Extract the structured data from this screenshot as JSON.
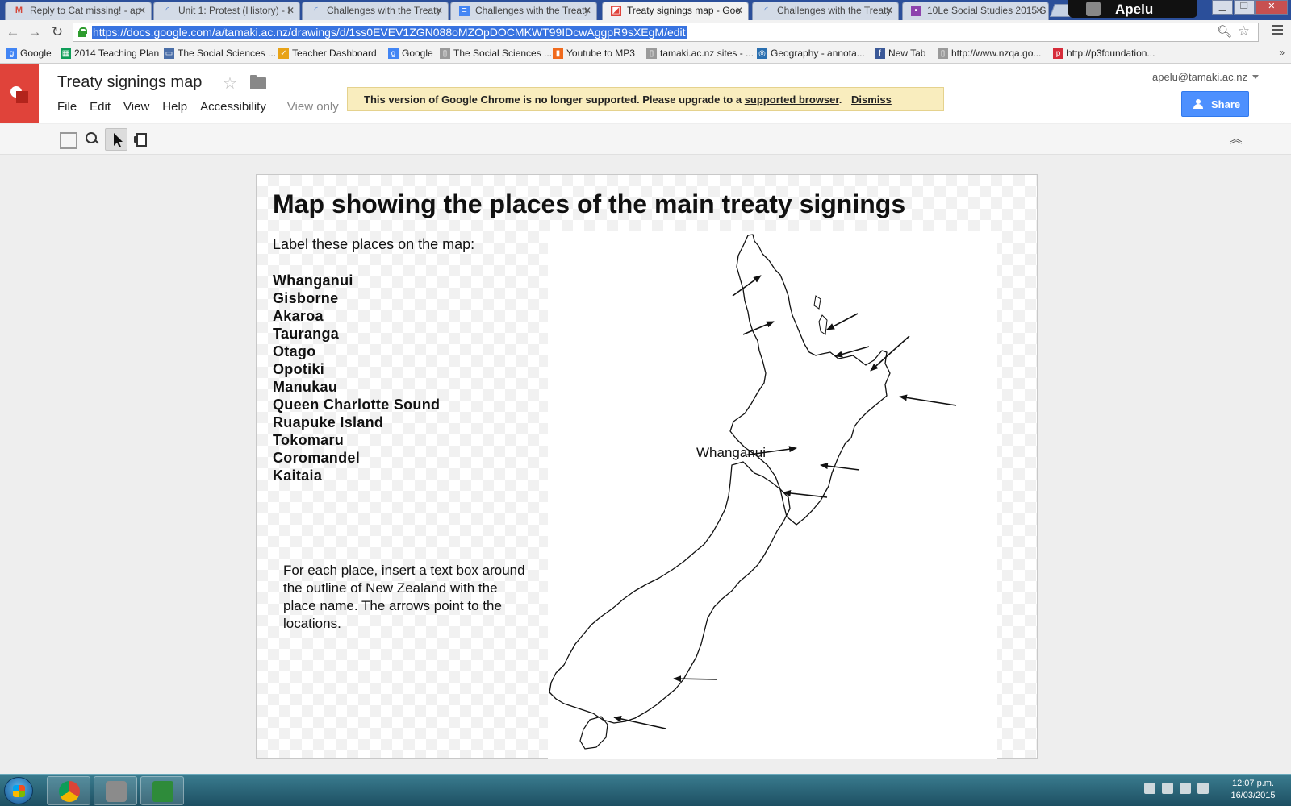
{
  "browser": {
    "tabs": [
      {
        "label": "Reply to Cat missing! - ap",
        "icon": "gmail-icon",
        "color": "#d44638"
      },
      {
        "label": "Unit 1: Protest (History) - I",
        "icon": "loading-icon",
        "color": "#4a7bd0"
      },
      {
        "label": "Challenges with the Treaty",
        "icon": "loading-icon",
        "color": "#4a7bd0"
      },
      {
        "label": "Challenges with the Treaty",
        "icon": "docs-icon",
        "color": "#4285f4"
      },
      {
        "label": "Treaty signings map - Goo",
        "icon": "drawings-icon",
        "color": "#e0433a",
        "active": true
      },
      {
        "label": "Challenges with the Treaty",
        "icon": "loading-icon",
        "color": "#4a7bd0"
      },
      {
        "label": "10Le Social Studies 2015 S",
        "icon": "classroom-icon",
        "color": "#8e44ad"
      }
    ],
    "profile_name": "Apelu",
    "url": "https://docs.google.com/a/tamaki.ac.nz/drawings/d/1ss0EVEV1ZGN088oMZOpDOCMKWT99IDcwAggpR9sXEgM/edit",
    "bookmarks": [
      {
        "label": "Google",
        "color": "#4285f4",
        "glyph": "g"
      },
      {
        "label": "2014 Teaching Plan",
        "color": "#0f9d58",
        "glyph": "▦"
      },
      {
        "label": "The Social Sciences ...",
        "color": "#4a6ea8",
        "glyph": "▭"
      },
      {
        "label": "Teacher Dashboard",
        "color": "#e8a317",
        "glyph": "✓"
      },
      {
        "label": "Google",
        "color": "#4285f4",
        "glyph": "g"
      },
      {
        "label": "The Social Sciences ...",
        "color": "#888888",
        "glyph": "▯"
      },
      {
        "label": "Youtube to MP3",
        "color": "#f06a1d",
        "glyph": "▮"
      },
      {
        "label": "tamaki.ac.nz sites - ...",
        "color": "#888888",
        "glyph": "▯"
      },
      {
        "label": "Geography - annota...",
        "color": "#2a6fb0",
        "glyph": "◎"
      },
      {
        "label": "New Tab",
        "color": "#3b5998",
        "glyph": "f"
      },
      {
        "label": "http://www.nzqa.go...",
        "color": "#888888",
        "glyph": "▯"
      },
      {
        "label": "http://p3foundation...",
        "color": "#d62c3a",
        "glyph": "p"
      }
    ],
    "bookmarks_more": "»"
  },
  "docs": {
    "title": "Treaty signings map",
    "menu": [
      "File",
      "Edit",
      "View",
      "Help",
      "Accessibility"
    ],
    "view_only": "View only",
    "banner_text": "This version of Google Chrome is no longer supported. Please upgrade to a",
    "banner_link": "supported browser",
    "banner_dot": ".",
    "banner_dismiss": "Dismiss",
    "user_email": "apelu@tamaki.ac.nz",
    "share_label": "Share"
  },
  "drawing": {
    "title": "Map showing the places of the main treaty signings",
    "instruction": "Label these places on the map:",
    "places": [
      "Whanganui",
      "Gisborne",
      "Akaroa",
      "Tauranga",
      "Otago",
      "Opotiki",
      "Manukau",
      "Queen Charlotte Sound",
      "Ruapuke Island",
      "Tokomaru",
      "Coromandel",
      "Kaitaia"
    ],
    "note": "For each place, insert a text box around the outline of New Zealand with the place name. The arrows point to the locations.",
    "map_label": "Whanganui"
  },
  "taskbar": {
    "time": "12:07 p.m.",
    "date": "16/03/2015"
  }
}
